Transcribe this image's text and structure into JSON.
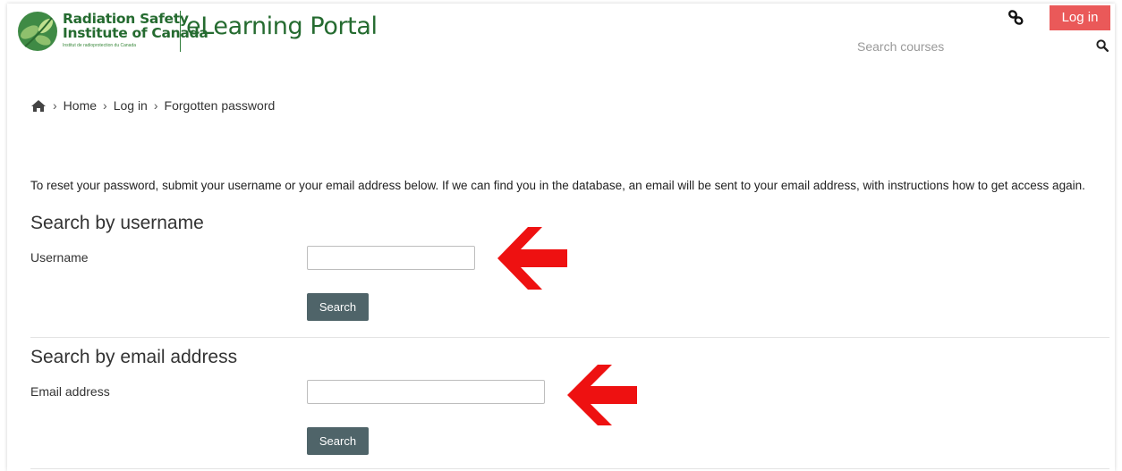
{
  "header": {
    "brand_line1": "Radiation Safety",
    "brand_line2": "Institute of Canada",
    "brand_line3": "Institut de radioprotection du Canada",
    "portal_title": "eLearning Portal",
    "login_label": "Log in",
    "search_placeholder": "Search courses",
    "brand_color": "#256b30",
    "login_color": "#ea5959"
  },
  "breadcrumb": {
    "home_icon": "home-icon",
    "items": [
      "Home",
      "Log in",
      "Forgotten password"
    ],
    "separator": "›"
  },
  "main": {
    "intro": "To reset your password, submit your username or your email address below. If we can find you in the database, an email will be sent to your email address, with instructions how to get access again.",
    "username_section": {
      "heading": "Search by username",
      "label": "Username",
      "value": "",
      "button_label": "Search"
    },
    "email_section": {
      "heading": "Search by email address",
      "label": "Email address",
      "value": "",
      "button_label": "Search"
    },
    "annotation_arrow_color": "#ee1111",
    "button_color": "#4f6469"
  }
}
